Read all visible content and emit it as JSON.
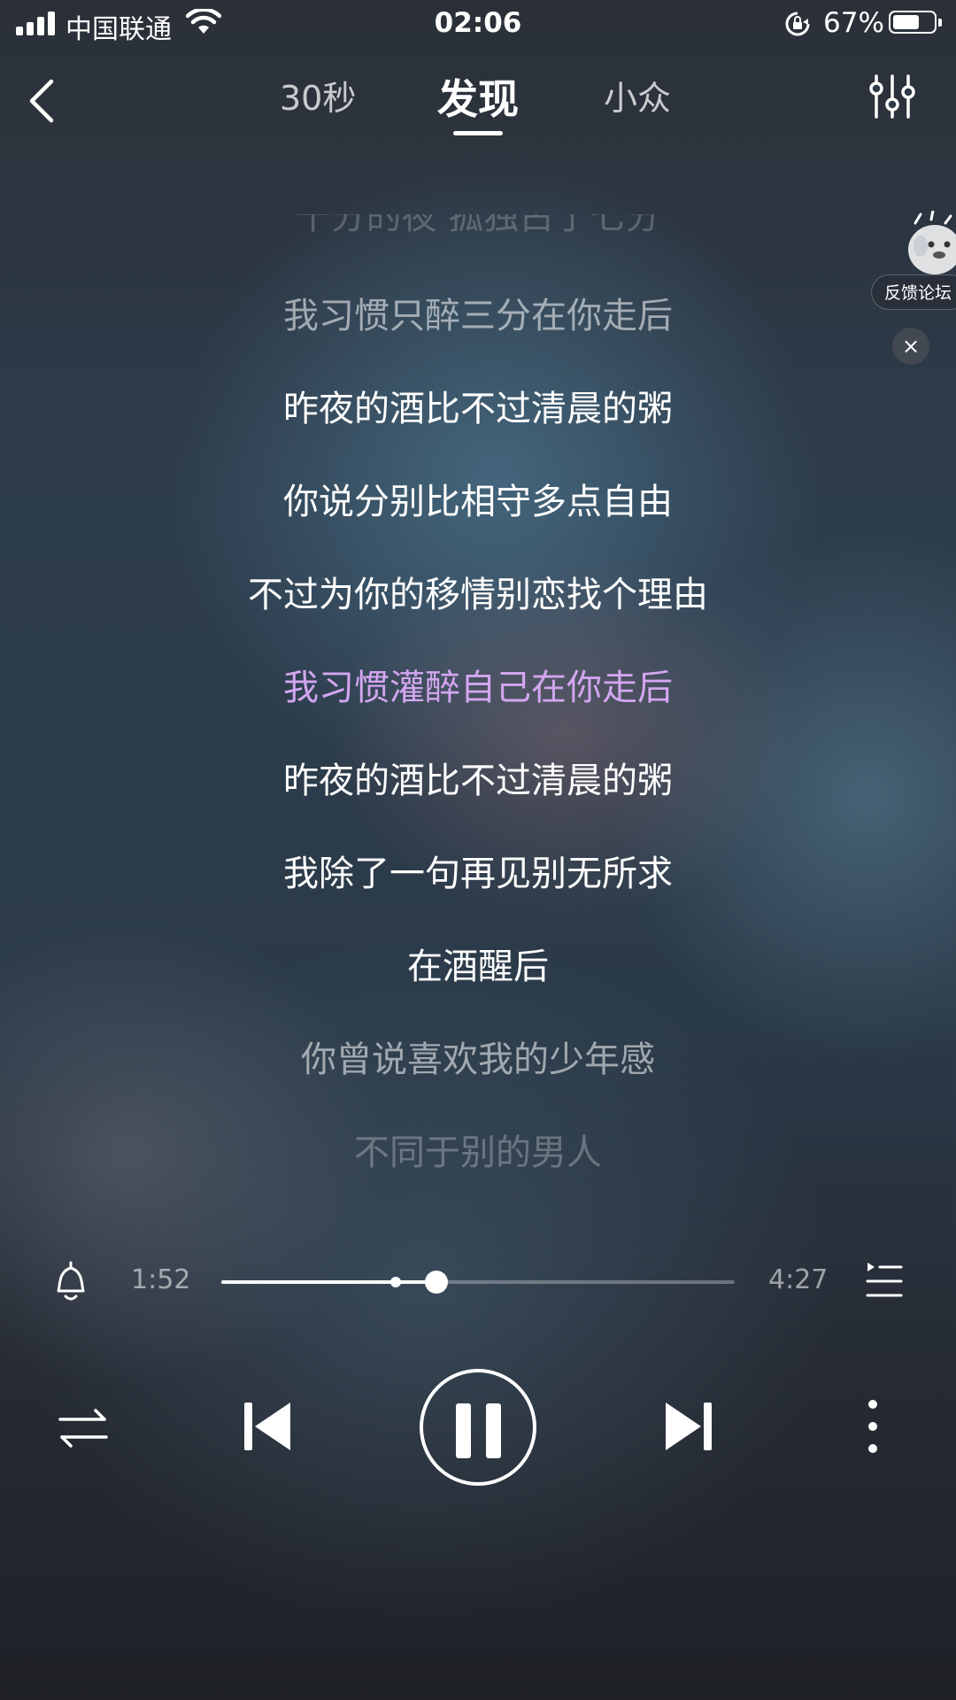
{
  "status_bar": {
    "carrier": "中国联通",
    "time": "02:06",
    "battery_percent": "67%",
    "battery_level": 0.67
  },
  "nav": {
    "tabs": [
      {
        "label": "30秒"
      },
      {
        "label": "发现",
        "active": true
      },
      {
        "label": "小众"
      }
    ]
  },
  "lyrics": {
    "lines": [
      "十分的夜  孤独占了七分",
      "我习惯只醉三分在你走后",
      "昨夜的酒比不过清晨的粥",
      "你说分别比相守多点自由",
      "不过为你的移情别恋找个理由",
      "我习惯灌醉自己在你走后",
      "昨夜的酒比不过清晨的粥",
      "我除了一句再见别无所求",
      "在酒醒后",
      "你曾说喜欢我的少年感",
      "不同于别的男人"
    ],
    "active_index": 5,
    "active_color": "#d3a6f0"
  },
  "feedback": {
    "label": "反馈论坛",
    "close_glyph": "×"
  },
  "player": {
    "current_time": "1:52",
    "total_time": "4:27",
    "progress": 0.419,
    "buffered": 0.34
  }
}
